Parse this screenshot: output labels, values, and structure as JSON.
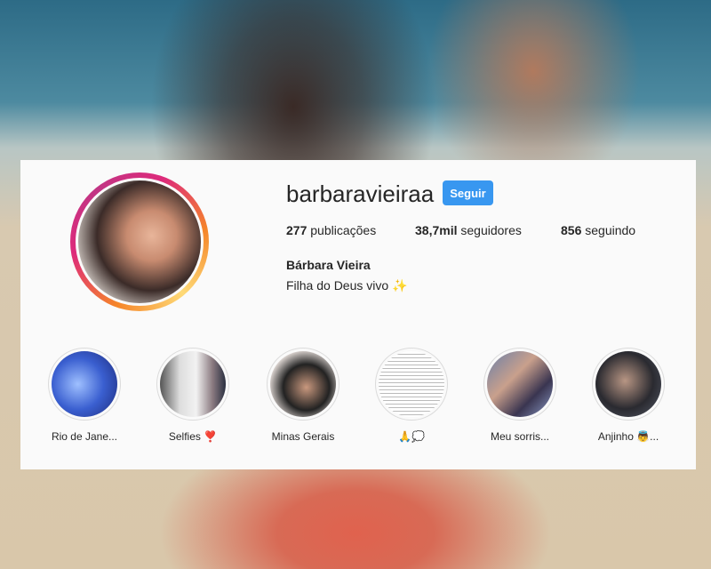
{
  "profile": {
    "username": "barbaravieiraa",
    "follow_label": "Seguir",
    "stats": [
      {
        "count": "277",
        "label": "publicações"
      },
      {
        "count": "38,7mil",
        "label": "seguidores"
      },
      {
        "count": "856",
        "label": "seguindo"
      }
    ],
    "full_name": "Bárbara Vieira",
    "bio": "Filha do Deus vivo ✨"
  },
  "highlights": [
    {
      "label": "Rio de Jane..."
    },
    {
      "label": "Selfies ❣️"
    },
    {
      "label": "Minas Gerais"
    },
    {
      "label": "🙏💭"
    },
    {
      "label": "Meu sorris..."
    },
    {
      "label": "Anjinho 👼..."
    }
  ],
  "colors": {
    "accent": "#3897f0",
    "card_bg": "#fafafa"
  }
}
